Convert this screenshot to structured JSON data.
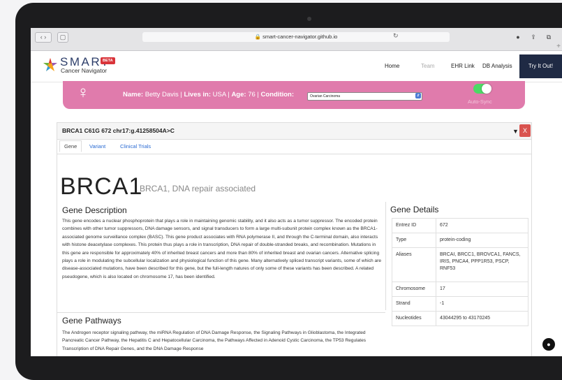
{
  "browser": {
    "url": "smart-cancer-navigator.github.io"
  },
  "header": {
    "logo_title": "SMART",
    "logo_subtitle": "Cancer Navigator",
    "badge": "BETA",
    "nav": [
      {
        "label": "Home",
        "active": true
      },
      {
        "label": "Team",
        "active": false
      },
      {
        "label": "EHR Link",
        "active": true
      },
      {
        "label": "DB Analysis",
        "active": true
      }
    ],
    "cta": "Try It Out!"
  },
  "patient": {
    "name_label": "Name:",
    "name": "Betty Davis",
    "lives_label": "Lives in:",
    "lives": "USA",
    "age_label": "Age:",
    "age": "76",
    "condition_label": "Condition:",
    "condition": "Ovarian Carcinoma",
    "autosync_label": "Auto-Sync",
    "autosync_on": true,
    "accent_color": "#e07bac"
  },
  "variant": {
    "title": "BRCA1 C61G 672 chr17:g.41258504A>C",
    "tabs": [
      {
        "label": "Gene",
        "active": true
      },
      {
        "label": "Variant",
        "active": false
      },
      {
        "label": "Clinical Trials",
        "active": false
      }
    ],
    "close_label": "X"
  },
  "gene": {
    "symbol": "BRCA1",
    "full_name": "BRCA1, DNA repair associated",
    "description_title": "Gene Description",
    "description": "This gene encodes a nuclear phosphoprotein that plays a role in maintaining genomic stability, and it also acts as a tumor suppressor. The encoded protein combines with other tumor suppressors, DNA damage sensors, and signal transducers to form a large multi-subunit protein complex known as the BRCA1-associated genome surveillance complex (BASC). This gene product associates with RNA polymerase II, and through the C-terminal domain, also interacts with histone deacetylase complexes. This protein thus plays a role in transcription, DNA repair of double-stranded breaks, and recombination. Mutations in this gene are responsible for approximately 40% of inherited breast cancers and more than 80% of inherited breast and ovarian cancers. Alternative splicing plays a role in modulating the subcellular localization and physiological function of this gene. Many alternatively spliced transcript variants, some of which are disease-associated mutations, have been described for this gene, but the full-length natures of only some of these variants has been described. A related pseudogene, which is also located on chromosome 17, has been identified.",
    "pathways_title": "Gene Pathways",
    "pathways": "The Androgen receptor signaling pathway, the miRNA Regulation of DNA Damage Response, the Signaling Pathways in Glioblastoma, the Integrated Pancreatic Cancer Pathway, the Hepatitis C and Hepatocellular Carcinoma, the Pathways Affected in Adenoid Cystic Carcinoma, the TP53 Regulates Transcription of DNA Repair Genes, and the DNA Damage Response",
    "details_title": "Gene Details",
    "details": [
      {
        "key": "Entrez ID",
        "value": "672"
      },
      {
        "key": "Type",
        "value": "protein-coding"
      },
      {
        "key": "Aliases",
        "value": "BRCAI, BRCC1, BROVCA1, FANCS, IRIS, PNCA4, PPP1R53, PSCP, RNF53"
      },
      {
        "key": "Chromosome",
        "value": "17"
      },
      {
        "key": "Strand",
        "value": "-1"
      },
      {
        "key": "Nucleotides",
        "value": "43044295 to 43170245"
      }
    ]
  }
}
